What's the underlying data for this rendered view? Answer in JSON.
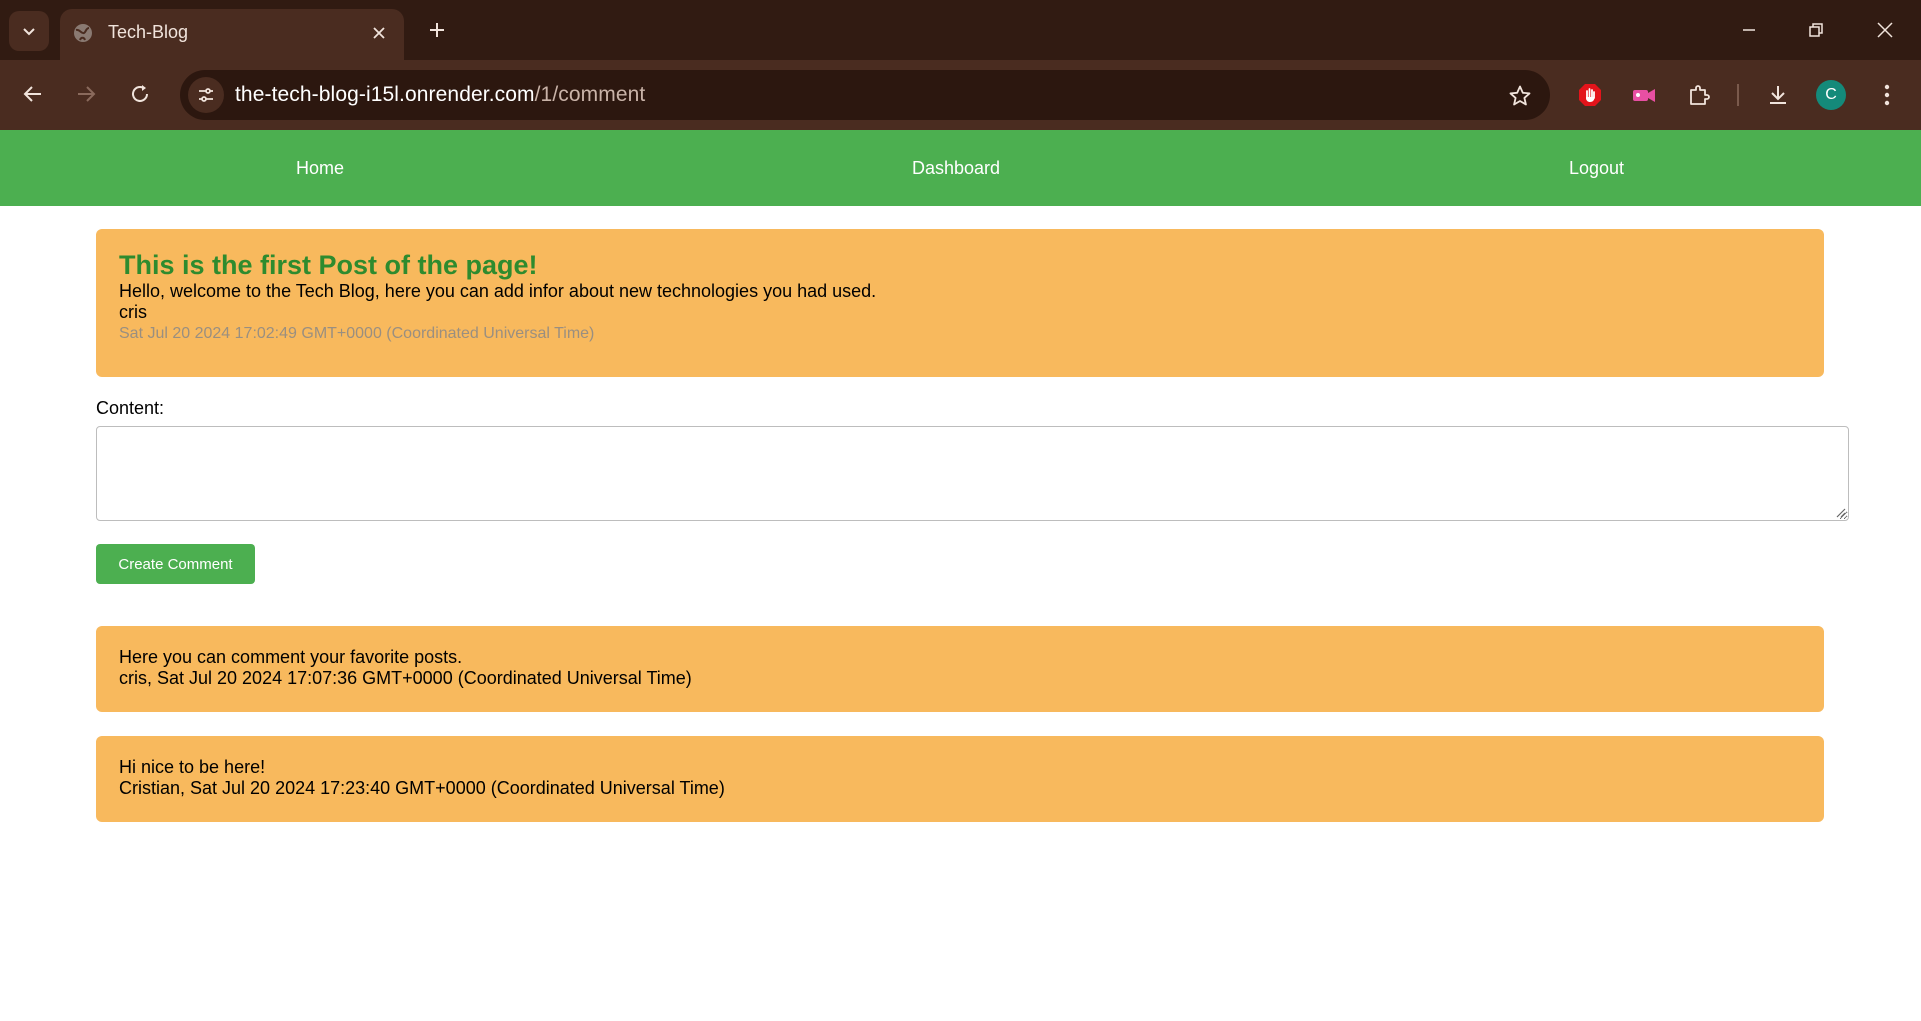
{
  "browser": {
    "tab": {
      "title": "Tech-Blog"
    },
    "address": {
      "host": "the-tech-blog-i15l.onrender.com",
      "path": "/1/comment"
    },
    "profile_initial": "C",
    "icons": {
      "tab_search": "chevron-down-icon",
      "favicon": "globe-icon",
      "tab_close": "close-icon",
      "new_tab": "plus-icon",
      "back": "arrow-left-icon",
      "forward": "arrow-right-icon",
      "reload": "reload-icon",
      "site_info": "tune-icon",
      "bookmark": "star-icon",
      "extensions": [
        "stop-hand-icon",
        "video-camera-icon",
        "puzzle-icon"
      ],
      "download": "download-icon",
      "menu": "kebab-menu-icon"
    },
    "colors": {
      "frame": "#311b12",
      "toolbar": "#4a2c20",
      "omnibox": "#2c170f"
    }
  },
  "nav": {
    "home": "Home",
    "dashboard": "Dashboard",
    "logout": "Logout",
    "color": "#4caf50"
  },
  "post": {
    "title": "This is the first Post of the page!",
    "body": "Hello, welcome to the Tech Blog, here you can add infor about new technologies you had used.",
    "author": "cris",
    "date": "Sat Jul 20 2024 17:02:49 GMT+0000 (Coordinated Universal Time)"
  },
  "form": {
    "label": "Content:",
    "value": "",
    "submit_label": "Create Comment"
  },
  "comments": [
    {
      "text": "Here you can comment your favorite posts.",
      "meta": "cris, Sat Jul 20 2024 17:07:36 GMT+0000 (Coordinated Universal Time)"
    },
    {
      "text": "Hi nice to be here!",
      "meta": "Cristian, Sat Jul 20 2024 17:23:40 GMT+0000 (Coordinated Universal Time)"
    }
  ],
  "card_color": "#f8b95d"
}
